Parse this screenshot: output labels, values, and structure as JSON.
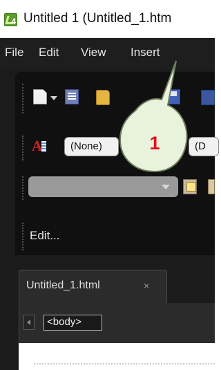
{
  "window": {
    "title": "Untitled 1 (Untitled_1.htm"
  },
  "menubar": {
    "items": [
      "File",
      "Edit",
      "View",
      "Insert"
    ]
  },
  "toolbar": {
    "style_value": "(None)",
    "font_value": "(D",
    "edit_label": "Edit..."
  },
  "document_tab": {
    "label": "Untitled_1.html",
    "close_glyph": "×"
  },
  "tag_bar": {
    "tag": "<body>"
  },
  "callout": {
    "number": "1"
  },
  "icons": [
    "app-icon",
    "new-document-icon",
    "template-icon",
    "open-folder-icon",
    "save-icon",
    "style-icon",
    "paste-icon",
    "tab-close-icon",
    "scroll-left-icon"
  ],
  "colors": {
    "dark_bg": "#1b1b1b",
    "callout_fill": "#e9f3db",
    "callout_text": "#e0111f"
  }
}
